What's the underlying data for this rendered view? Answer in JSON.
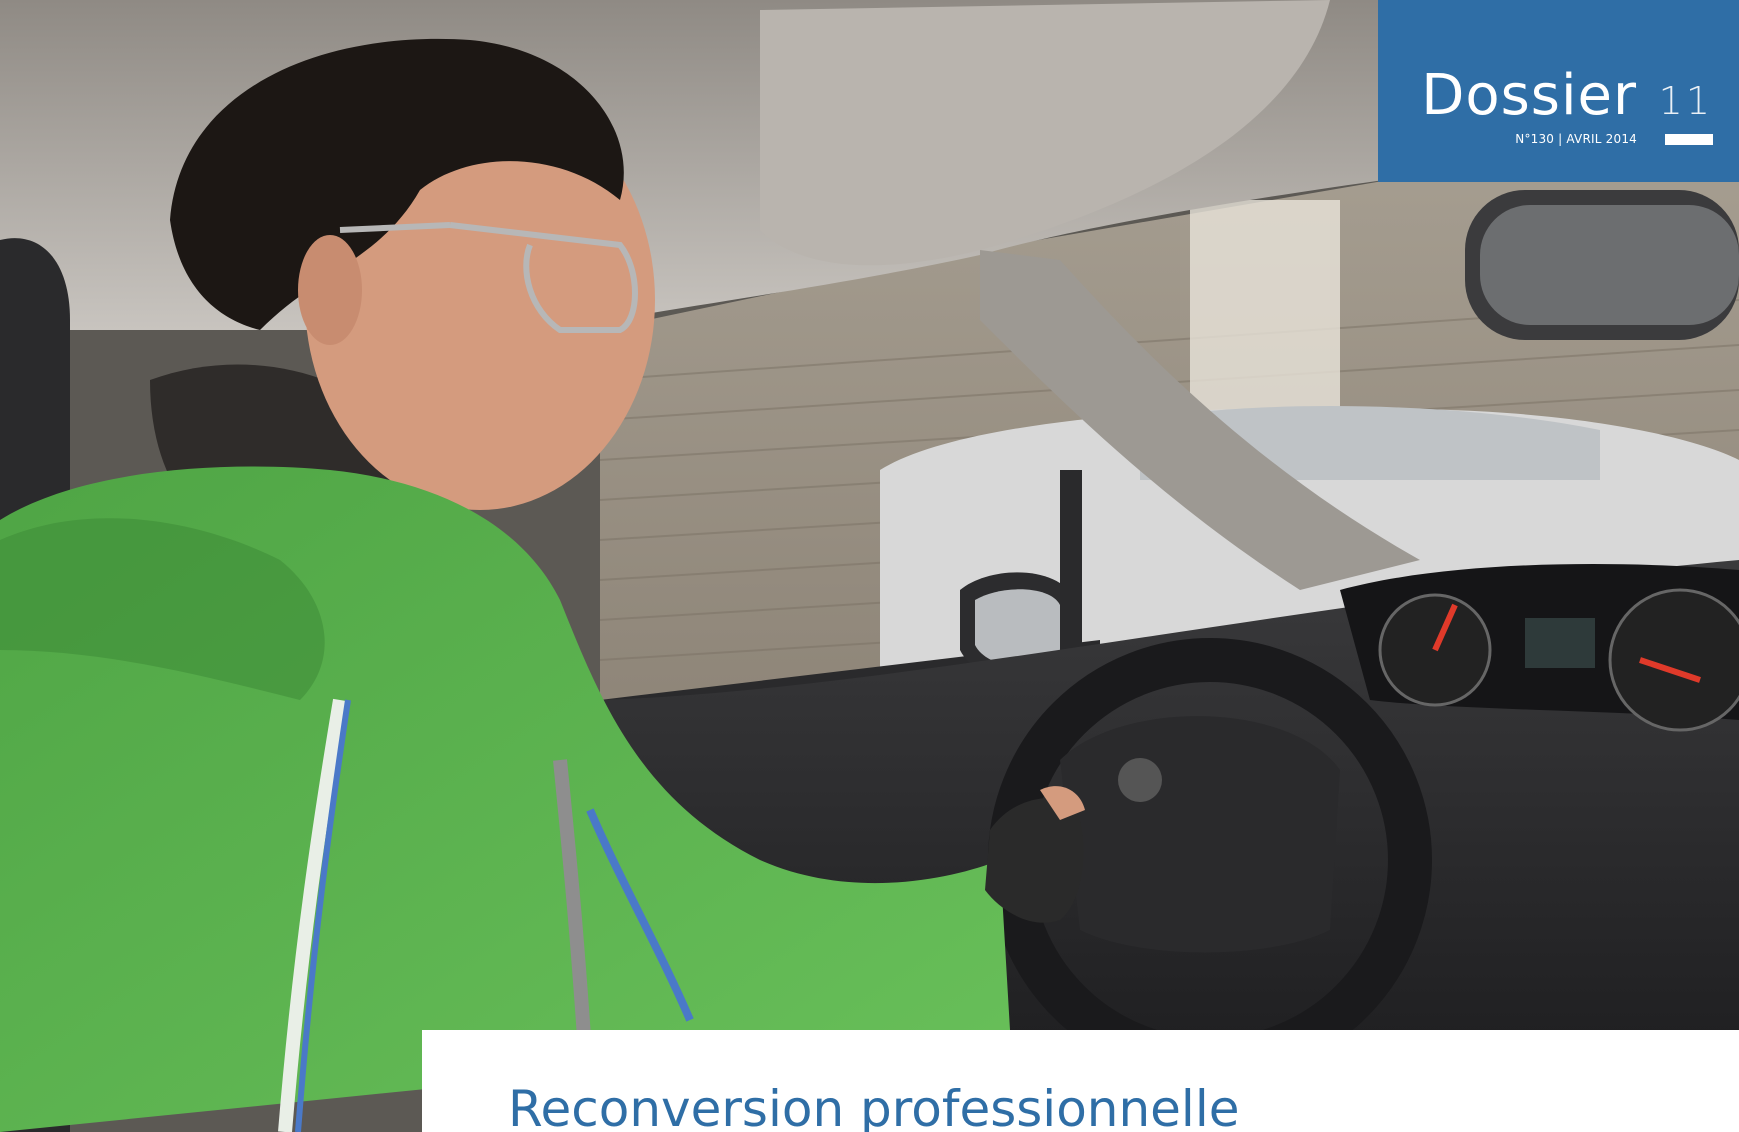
{
  "header": {
    "section": "Dossier",
    "issue": "N°130 | AVRIL 2014",
    "page_number": "11"
  },
  "article": {
    "title": "Reconversion professionnelle"
  },
  "colors": {
    "accent_blue": "#2f6ea6",
    "jacket_green": "#56b14a"
  }
}
